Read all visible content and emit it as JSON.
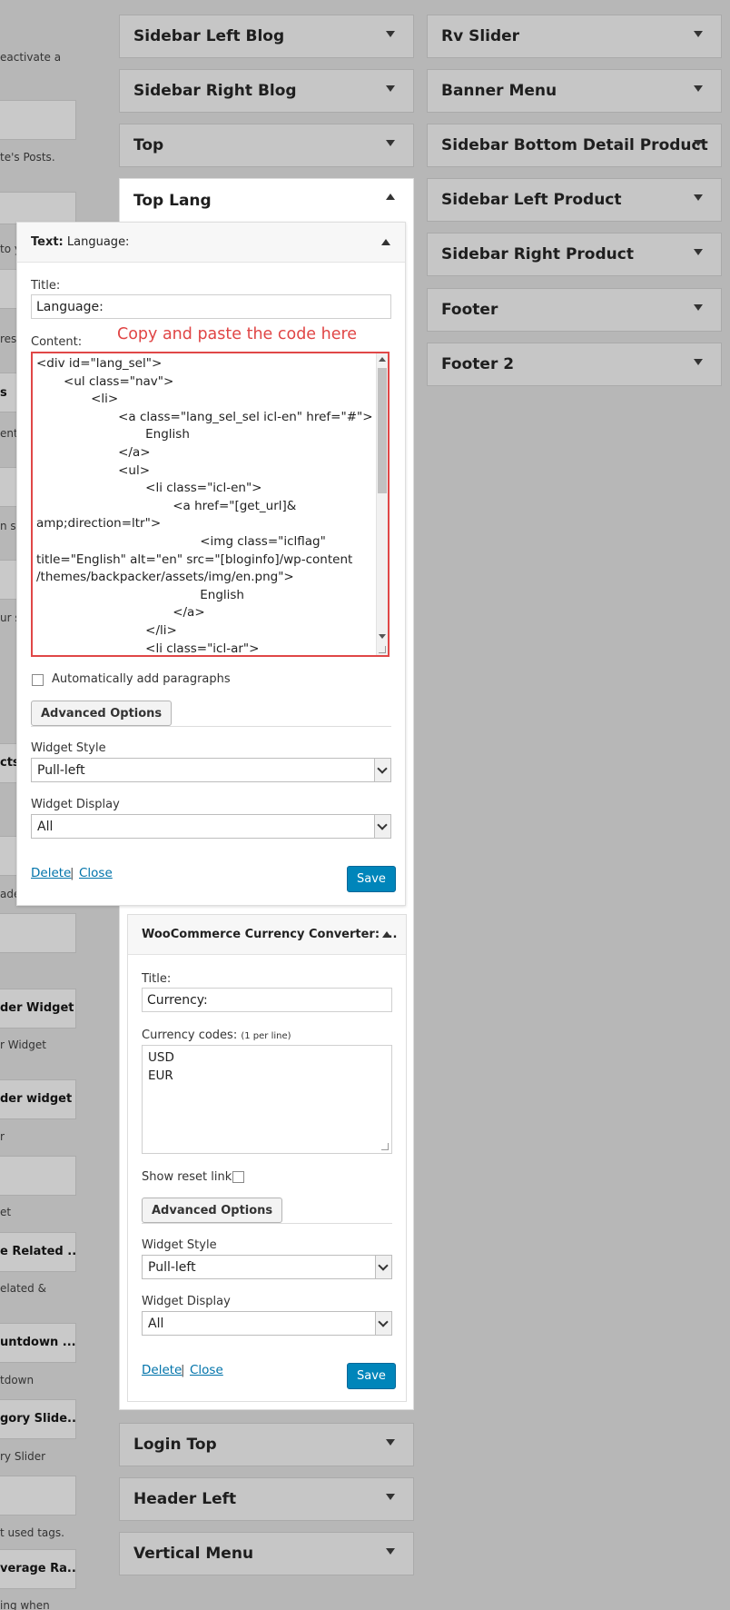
{
  "left_column": {
    "texts": [
      {
        "t": "eactivate a"
      },
      {
        "t": "te's Posts."
      },
      {
        "t": "to y"
      },
      {
        "t": "res"
      },
      {
        "t": "s"
      },
      {
        "t": "ent"
      },
      {
        "t": "n sli"
      },
      {
        "t": "ur s"
      },
      {
        "t": "cts"
      },
      {
        "t": "ade"
      },
      {
        "t": "der Widget"
      },
      {
        "t": "r Widget"
      },
      {
        "t": "der widget"
      },
      {
        "t": "r"
      },
      {
        "t": "et"
      },
      {
        "t": "e Related ..."
      },
      {
        "t": "elated &"
      },
      {
        "t": "untdown ..."
      },
      {
        "t": "tdown"
      },
      {
        "t": "gory Slide..."
      },
      {
        "t": "ry Slider"
      },
      {
        "t": "t used tags."
      },
      {
        "t": "verage Ra..."
      },
      {
        "t": "ing when"
      }
    ]
  },
  "sidebars_middle": [
    {
      "title": "Sidebar Left Blog"
    },
    {
      "title": "Sidebar Right Blog"
    },
    {
      "title": "Top"
    },
    {
      "title": "Top Lang"
    },
    {
      "title": "Login Top"
    },
    {
      "title": "Header Left"
    },
    {
      "title": "Vertical Menu"
    }
  ],
  "sidebars_right": [
    {
      "title": "Rv Slider"
    },
    {
      "title": "Banner Menu"
    },
    {
      "title": "Sidebar Bottom Detail Product"
    },
    {
      "title": "Sidebar Left Product"
    },
    {
      "title": "Sidebar Right Product"
    },
    {
      "title": "Footer"
    },
    {
      "title": "Footer 2"
    }
  ],
  "text_widget": {
    "type_label": "Text:",
    "name": "Language:",
    "title_label": "Title:",
    "title_value": "Language:",
    "content_label": "Content:",
    "annotation": "Copy and paste the code here",
    "content_value": "<div id=\"lang_sel\">\n       <ul class=\"nav\">\n              <li>\n                     <a class=\"lang_sel_sel icl-en\" href=\"#\">\n                            English\n                     </a>\n                     <ul>\n                            <li class=\"icl-en\">\n                                   <a href=\"[get_url]&\namp;direction=ltr\">\n                                          <img class=\"iclflag\"\ntitle=\"English\" alt=\"en\" src=\"[bloginfo]/wp-content\n/themes/backpacker/assets/img/en.png\">\n                                          English\n                                   </a>\n                            </li>\n                            <li class=\"icl-ar\">",
    "auto_paragraphs_label": "Automatically add paragraphs",
    "advanced_label": "Advanced Options",
    "style_label": "Widget Style",
    "style_value": "Pull-left",
    "display_label": "Widget Display",
    "display_value": "All",
    "delete_label": "Delete",
    "close_label": "Close",
    "separator": "|",
    "save_label": "Save"
  },
  "currency_widget": {
    "title": "WooCommerce Currency Converter: ...",
    "title_label": "Title:",
    "title_value": "Currency:",
    "codes_label": "Currency codes:",
    "codes_hint": "(1 per line)",
    "codes_value": "USD\nEUR",
    "reset_label": "Show reset link:",
    "advanced_label": "Advanced Options",
    "style_label": "Widget Style",
    "style_value": "Pull-left",
    "display_label": "Widget Display",
    "display_value": "All",
    "delete_label": "Delete",
    "close_label": "Close",
    "separator": "|",
    "save_label": "Save"
  },
  "colors": {
    "background": "#b7b7b7",
    "annotation": "#e04545",
    "primary_button": "#0085ba",
    "link": "#0073aa"
  }
}
